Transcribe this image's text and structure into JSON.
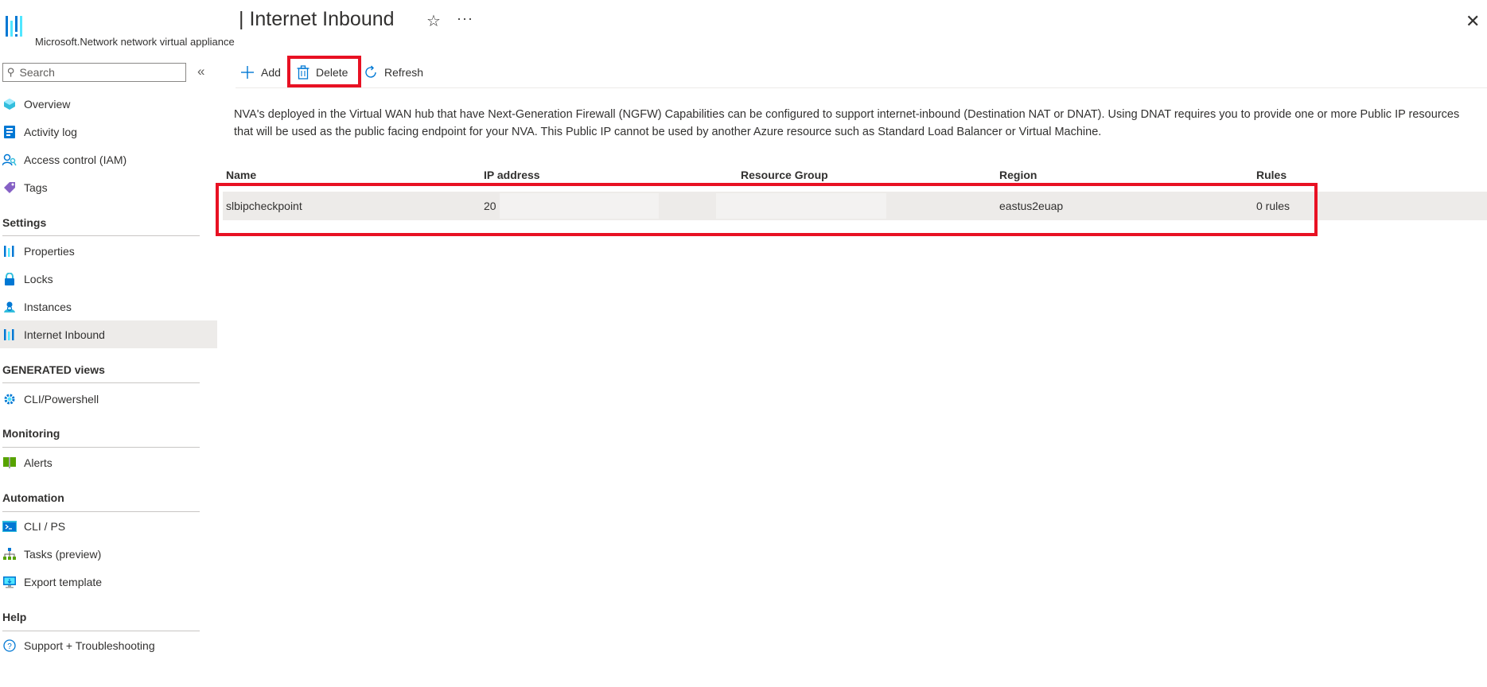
{
  "header": {
    "title": "| Internet Inbound",
    "subtitle": "Microsoft.Network network virtual appliance"
  },
  "search": {
    "placeholder": "Search"
  },
  "sidebar": {
    "items_top": [
      {
        "label": "Overview",
        "icon": "overview-icon"
      },
      {
        "label": "Activity log",
        "icon": "activity-log-icon"
      },
      {
        "label": "Access control (IAM)",
        "icon": "iam-icon"
      },
      {
        "label": "Tags",
        "icon": "tag-icon"
      }
    ],
    "sections": [
      {
        "title": "Settings",
        "items": [
          "Properties",
          "Locks",
          "Instances",
          "Internet Inbound"
        ]
      },
      {
        "title": "GENERATED views",
        "items": [
          "CLI/Powershell"
        ]
      },
      {
        "title": "Monitoring",
        "items": [
          "Alerts"
        ]
      },
      {
        "title": "Automation",
        "items": [
          "CLI / PS",
          "Tasks (preview)",
          "Export template"
        ]
      },
      {
        "title": "Help",
        "items": [
          "Support + Troubleshooting"
        ]
      }
    ],
    "active_item": "Internet Inbound"
  },
  "toolbar": {
    "add_label": "Add",
    "delete_label": "Delete",
    "refresh_label": "Refresh"
  },
  "description": "NVA's deployed in the Virtual WAN hub that have Next-Generation Firewall (NGFW) Capabilities can be configured to support internet-inbound (Destination NAT or DNAT). Using DNAT requires you to provide one or more Public IP resources that will be used as the public facing endpoint for your NVA. This Public IP cannot be used by another Azure resource such as Standard Load Balancer or Virtual Machine.",
  "table": {
    "columns": [
      "Name",
      "IP address",
      "Resource Group",
      "Region",
      "Rules"
    ],
    "rows": [
      {
        "name": "slbipcheckpoint",
        "ip": "20",
        "resource_group": "",
        "region": "eastus2euap",
        "rules": "0 rules"
      }
    ]
  },
  "colors": {
    "accent": "#0078d4",
    "highlight": "#e81123",
    "active_bg": "#edebe9"
  }
}
